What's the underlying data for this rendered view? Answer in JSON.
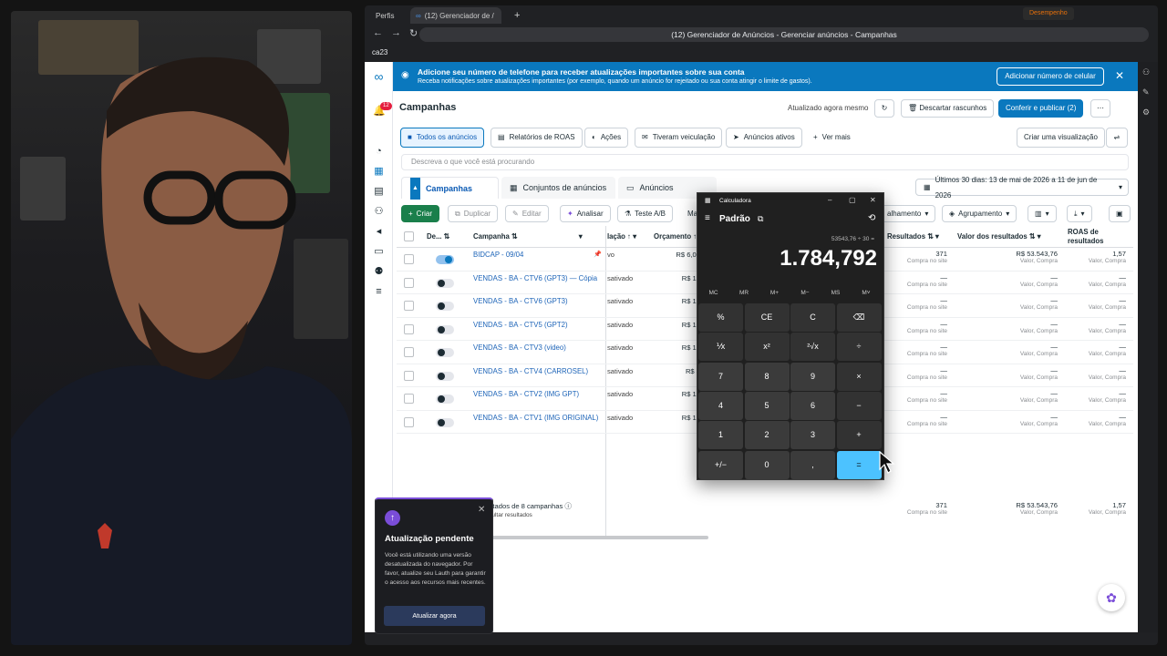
{
  "browser": {
    "tabs": [
      "Perfis",
      "(12) Gerenciador de /",
      "+"
    ],
    "url": "(12) Gerenciador de Anúncios - Gerenciar anúncios - Campanhas",
    "bookmark": "ca23",
    "performance_label": "Desempenho"
  },
  "sidebar": {
    "notification_count": "12"
  },
  "notice": {
    "title": "Adicione seu número de telefone para receber atualizações importantes sobre sua conta",
    "body": "Receba notificações sobre atualizações importantes (por exemplo, quando um anúncio for rejeitado ou sua conta atingir o limite de gastos).",
    "button": "Adicionar número de celular"
  },
  "header": {
    "title": "Campanhas",
    "updated": "Atualizado agora mesmo",
    "discard": "Descartar rascunhos",
    "publish": "Conferir e publicar (2)"
  },
  "filters": {
    "chips": [
      "Todos os anúncios",
      "Relatórios de ROAS",
      "Ações",
      "Tiveram veiculação",
      "Anúncios ativos",
      "Ver mais"
    ],
    "create_view": "Criar uma visualização",
    "search_placeholder": "Descreva o que você está procurando"
  },
  "levels": {
    "tabs": [
      "Campanhas",
      "Conjuntos de anúncios",
      "Anúncios"
    ]
  },
  "date_range": "Últimos 30 dias: 13 de mai de 2026 a 11 de jun de 2026",
  "toolbar": {
    "create": "Criar",
    "duplicate": "Duplicar",
    "edit": "Editar",
    "analyze": "Analisar",
    "ab_test": "Teste A/B",
    "more": "Ma",
    "breakdown": "alhamento",
    "grouping": "Agrupamento"
  },
  "table": {
    "headers": {
      "delivery": "De...",
      "campaign": "Campanha",
      "status": "lação",
      "budget": "Orçamento",
      "results": "Resultados",
      "value": "Valor dos resultados",
      "roas": "ROAS de resultados"
    },
    "rows": [
      {
        "name": "BIDCAP - 09/04",
        "status": "vo",
        "budget": "R$ 6,00",
        "on": true,
        "results": "371",
        "results_sub": "Compra no site",
        "value": "R$ 53.543,76",
        "value_sub": "Valor, Compra",
        "roas": "1,57",
        "roas_sub": "Valor, Compra"
      },
      {
        "name": "VENDAS - BA - CTV6 (GPT3) — Cópia",
        "status": "sativado",
        "budget": "R$ 10",
        "on": false,
        "results": "—",
        "results_sub": "Compra no site",
        "value": "—",
        "value_sub": "Valor, Compra",
        "roas": "—",
        "roas_sub": "Valor, Compra"
      },
      {
        "name": "VENDAS - BA - CTV6 (GPT3)",
        "status": "sativado",
        "budget": "R$ 10",
        "on": false,
        "results": "—",
        "results_sub": "Compra no site",
        "value": "—",
        "value_sub": "Valor, Compra",
        "roas": "—",
        "roas_sub": "Valor, Compra"
      },
      {
        "name": "VENDAS - BA - CTV5 (GPT2)",
        "status": "sativado",
        "budget": "R$ 10",
        "on": false,
        "results": "—",
        "results_sub": "Compra no site",
        "value": "—",
        "value_sub": "Valor, Compra",
        "roas": "—",
        "roas_sub": "Valor, Compra"
      },
      {
        "name": "VENDAS - BA - CTV3 (video)",
        "status": "sativado",
        "budget": "R$ 10",
        "on": false,
        "results": "—",
        "results_sub": "Compra no site",
        "value": "—",
        "value_sub": "Valor, Compra",
        "roas": "—",
        "roas_sub": "Valor, Compra"
      },
      {
        "name": "VENDAS - BA - CTV4 (CARROSEL)",
        "status": "sativado",
        "budget": "R$ 4",
        "on": false,
        "results": "—",
        "results_sub": "Compra no site",
        "value": "—",
        "value_sub": "Valor, Compra",
        "roas": "—",
        "roas_sub": "Valor, Compra"
      },
      {
        "name": "VENDAS - BA - CTV2 (IMG GPT)",
        "status": "sativado",
        "budget": "R$ 10",
        "on": false,
        "results": "—",
        "results_sub": "Compra no site",
        "value": "—",
        "value_sub": "Valor, Compra",
        "roas": "—",
        "roas_sub": "Valor, Compra"
      },
      {
        "name": "VENDAS - BA - CTV1 (IMG ORIGINAL)",
        "status": "sativado",
        "budget": "R$ 10",
        "on": false,
        "results": "—",
        "results_sub": "Compra no site",
        "value": "—",
        "value_sub": "Valor, Compra",
        "roas": "—",
        "roas_sub": "Valor, Compra"
      }
    ],
    "summary": {
      "label": "Resultados de 8 campanhas",
      "hide": "Ocultar resultados",
      "results": "371",
      "results_sub": "Compra no site",
      "value": "R$ 53.543,76",
      "value_sub": "Valor, Compra",
      "roas": "1,57",
      "roas_sub": "Valor, Compra"
    }
  },
  "calculator": {
    "title": "Calculadora",
    "mode": "Padrão",
    "expression": "53543,76 ÷ 30 =",
    "display": "1.784,792",
    "memory": [
      "MC",
      "MR",
      "M+",
      "M−",
      "MS",
      "M˅"
    ],
    "keys": [
      "%",
      "CE",
      "C",
      "⌫",
      "⅟x",
      "x²",
      "²√x",
      "÷",
      "7",
      "8",
      "9",
      "×",
      "4",
      "5",
      "6",
      "−",
      "1",
      "2",
      "3",
      "+",
      "+/−",
      "0",
      ",",
      "="
    ]
  },
  "popup": {
    "title": "Atualização pendente",
    "body": "Você está utilizando uma versão desatualizada do navegador. Por favor, atualize seu Lauth para garantir o acesso aos recursos mais recentes.",
    "button": "Atualizar agora"
  }
}
